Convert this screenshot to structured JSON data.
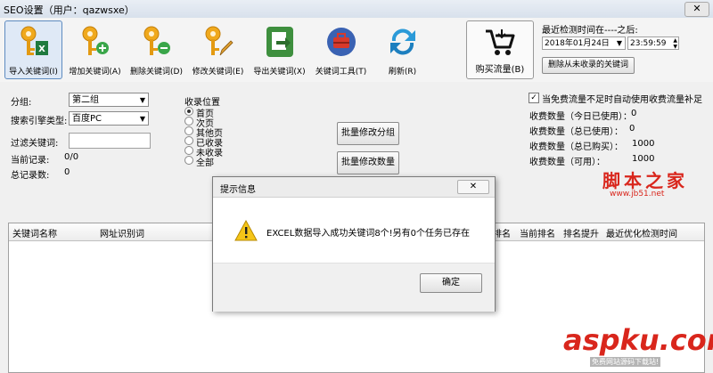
{
  "window": {
    "title": "SEO设置（用户：qazwsxe）"
  },
  "toolbar": {
    "buttons": [
      {
        "label": "导入关键词(I)"
      },
      {
        "label": "增加关键词(A)"
      },
      {
        "label": "删除关键词(D)"
      },
      {
        "label": "修改关键词(E)"
      },
      {
        "label": "导出关键词(X)"
      },
      {
        "label": "关键词工具(T)"
      },
      {
        "label": "刷新(R)"
      }
    ],
    "buy_label": "购买流量(B)"
  },
  "detect": {
    "title": "最近检测时间在----之后:",
    "date": "2018年01月24日",
    "time": "23:59:59",
    "delete_button": "删除从未收录的关键词"
  },
  "filters": {
    "group_label": "分组:",
    "group_value": "第二组",
    "engine_label": "搜索引擎类型:",
    "engine_value": "百度PC",
    "keyword_label": "过滤关键词:",
    "keyword_value": "",
    "current_label": "当前记录:",
    "current_value": "0/0",
    "total_label": "总记录数:",
    "total_value": "0"
  },
  "position": {
    "title": "收录位置",
    "options": [
      "首页",
      "次页",
      "其他页",
      "已收录",
      "未收录",
      "全部"
    ],
    "selected": 0
  },
  "batch": {
    "group_button": "批量修改分组",
    "count_button": "批量修改数量"
  },
  "traffic": {
    "auto_label": "当免费流量不足时自动使用收费流量补足",
    "auto_checked": true,
    "rows": [
      {
        "label": "收费数量（今日已使用）：",
        "value": "0"
      },
      {
        "label": "收费数量（总已使用）：",
        "value": "0"
      },
      {
        "label": "收费数量（总已购买）：",
        "value": "1000"
      },
      {
        "label": "收费数量（可用）：",
        "value": "1000"
      }
    ]
  },
  "grid": {
    "columns": [
      "关键词名称",
      "网址识别词",
      "排名",
      "当前排名",
      "排名提升",
      "最近优化检测时间"
    ]
  },
  "dialog": {
    "title": "提示信息",
    "message": "EXCEL数据导入成功关键词8个!另有0个任务已存在",
    "ok": "确定"
  },
  "watermark": {
    "top_cn": "脚本之家",
    "top_url": "www.jb51.net",
    "bottom": "aspku.com",
    "bottom_sub": "免费网站源码下载站!"
  },
  "colors": {
    "accent": "#5e8bc0",
    "warning": "#f5c518",
    "watermark_red": "#d9261c"
  }
}
